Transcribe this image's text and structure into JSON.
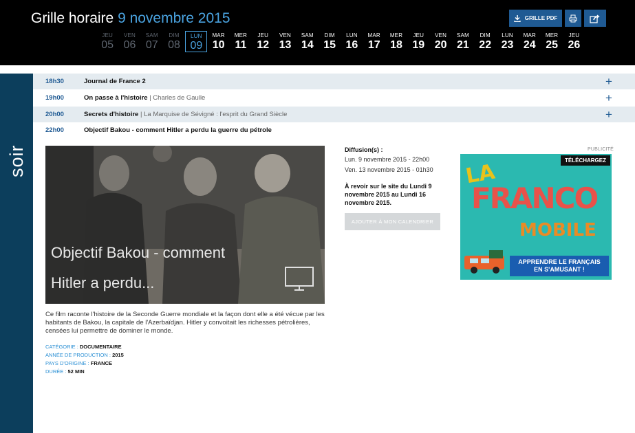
{
  "header": {
    "title": "Grille horaire",
    "date": "9 novembre 2015",
    "pdf_label": "GRILLE PDF"
  },
  "days": [
    {
      "name": "JEU",
      "num": "05"
    },
    {
      "name": "VEN",
      "num": "06"
    },
    {
      "name": "SAM",
      "num": "07"
    },
    {
      "name": "DIM",
      "num": "08"
    },
    {
      "name": "LUN",
      "num": "09"
    },
    {
      "name": "MAR",
      "num": "10"
    },
    {
      "name": "MER",
      "num": "11"
    },
    {
      "name": "JEU",
      "num": "12"
    },
    {
      "name": "VEN",
      "num": "13"
    },
    {
      "name": "SAM",
      "num": "14"
    },
    {
      "name": "DIM",
      "num": "15"
    },
    {
      "name": "LUN",
      "num": "16"
    },
    {
      "name": "MAR",
      "num": "17"
    },
    {
      "name": "MER",
      "num": "18"
    },
    {
      "name": "JEU",
      "num": "19"
    },
    {
      "name": "VEN",
      "num": "20"
    },
    {
      "name": "SAM",
      "num": "21"
    },
    {
      "name": "DIM",
      "num": "22"
    },
    {
      "name": "LUN",
      "num": "23"
    },
    {
      "name": "MAR",
      "num": "24"
    },
    {
      "name": "MER",
      "num": "25"
    },
    {
      "name": "JEU",
      "num": "26"
    }
  ],
  "section": "soir",
  "schedule": [
    {
      "time": "18h30",
      "title": "Journal de France 2",
      "subtitle": ""
    },
    {
      "time": "19h00",
      "title": "On passe à l'histoire",
      "subtitle": "Charles de Gaulle"
    },
    {
      "time": "20h00",
      "title": "Secrets d'histoire",
      "subtitle": "La Marquise de Sévigné : l'esprit du Grand Siècle"
    },
    {
      "time": "22h00",
      "title": "Objectif Bakou - comment Hitler a perdu la guerre du pétrole",
      "subtitle": ""
    }
  ],
  "detail": {
    "image_overlay_line1": "Objectif Bakou - comment",
    "image_overlay_line2": "Hitler a perdu...",
    "description": "Ce film raconte l'histoire de la Seconde Guerre mondiale et la façon dont elle a été vécue par les habitants de Bakou, la capitale de l'Azerbaïdjan. Hitler y convoitait les richesses pétrolières, censées lui permettre de dominer le monde.",
    "meta": [
      {
        "key": "CATÉGORIE : ",
        "value": "DOCUMENTAIRE"
      },
      {
        "key": "ANNÉE DE PRODUCTION : ",
        "value": "2015"
      },
      {
        "key": "PAYS D'ORIGINE : ",
        "value": "FRANCE"
      },
      {
        "key": "DURÉE : ",
        "value": "52 MIN"
      }
    ],
    "diffusion_title": "Diffusion(s) :",
    "diffusions": [
      "Lun. 9 novembre 2015 - 22h00",
      "Ven. 13 novembre 2015 - 01h30"
    ],
    "revoir": "À revoir sur le site du Lundi 9 novembre 2015 au Lundi 16 novembre 2015.",
    "calendar_button": "AJOUTER À MON CALENDRIER"
  },
  "ad": {
    "label": "PUBLICITÉ",
    "download": "TÉLÉCHARGEZ",
    "word1": "LA",
    "word2": "FRANCO",
    "word3": "MOBILE",
    "tagline1": "APPRENDRE LE FRANÇAIS",
    "tagline2": "EN S'AMUSANT !"
  },
  "colors": {
    "header_bg": "#000000",
    "accent_blue": "#4aa3e0",
    "button_blue": "#1f5a93",
    "sidebar_navy": "#0c3e5c",
    "row_alt": "#e4ebf0"
  }
}
